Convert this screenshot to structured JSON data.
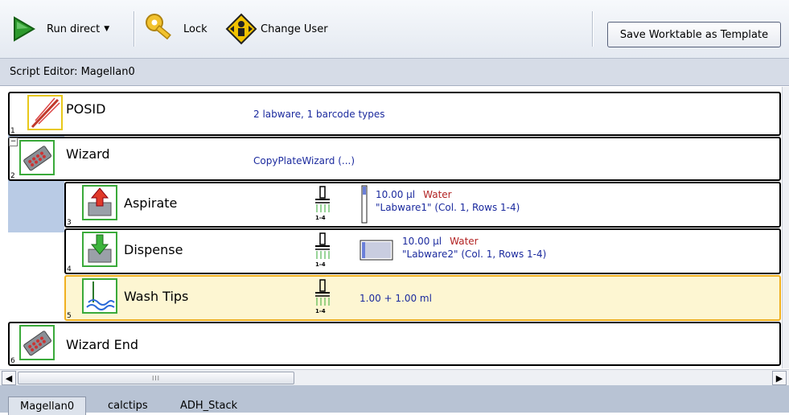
{
  "toolbar": {
    "run_direct": "Run direct",
    "lock": "Lock",
    "change_user": "Change User",
    "save_template": "Save Worktable as Template"
  },
  "editor": {
    "title": "Script Editor: Magellan0"
  },
  "rows": [
    {
      "num": "1",
      "name": "POSID",
      "info": "2 labware, 1 barcode types"
    },
    {
      "num": "2",
      "name": "Wizard",
      "info": "CopyPlateWizard (...)"
    },
    {
      "num": "3",
      "name": "Aspirate",
      "tips": "1-4",
      "volume": "10.00 µl",
      "liquid": "Water",
      "labware": "\"Labware1\" (Col. 1, Rows 1-4)"
    },
    {
      "num": "4",
      "name": "Dispense",
      "tips": "1-4",
      "volume": "10.00 µl",
      "liquid": "Water",
      "labware": "\"Labware2\" (Col. 1, Rows 1-4)"
    },
    {
      "num": "5",
      "name": "Wash Tips",
      "tips": "1-4",
      "info": "1.00 + 1.00 ml"
    },
    {
      "num": "6",
      "name": "Wizard End"
    }
  ],
  "tabs": [
    "Magellan0",
    "calctips",
    "ADH_Stack"
  ],
  "colors": {
    "selected_row": "#fdf6d2",
    "selected_border": "#f0b020",
    "info_text": "#1b2a9e",
    "liquid_text": "#b22222"
  }
}
